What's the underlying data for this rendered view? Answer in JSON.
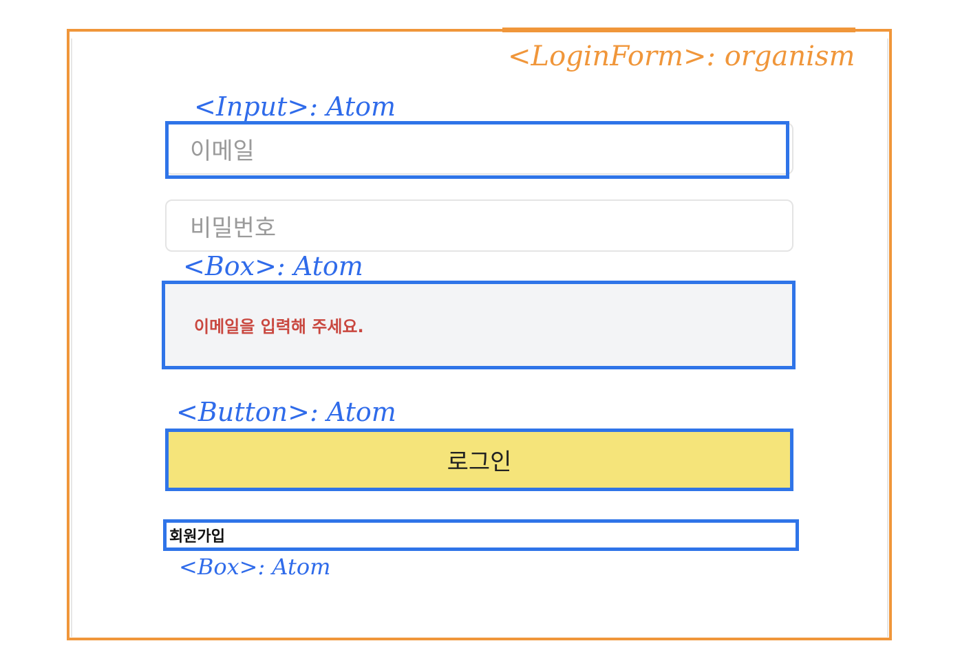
{
  "colors": {
    "organism_annotation": "#f0963a",
    "atom_annotation": "#2f74e8",
    "error_text": "#c9473f",
    "button_fill": "#f5e47a",
    "error_box_fill": "#f3f4f6"
  },
  "annotations": {
    "login_form": "<LoginForm>: organism",
    "input": "<Input>: Atom",
    "box_error": "<Box>: Atom",
    "button": "<Button>: Atom",
    "box_signup": "<Box>: Atom"
  },
  "form": {
    "email_placeholder": "이메일",
    "password_placeholder": "비밀번호",
    "error_message": "이메일을 입력해 주세요.",
    "login_label": "로그인",
    "signup_label": "회원가입"
  }
}
